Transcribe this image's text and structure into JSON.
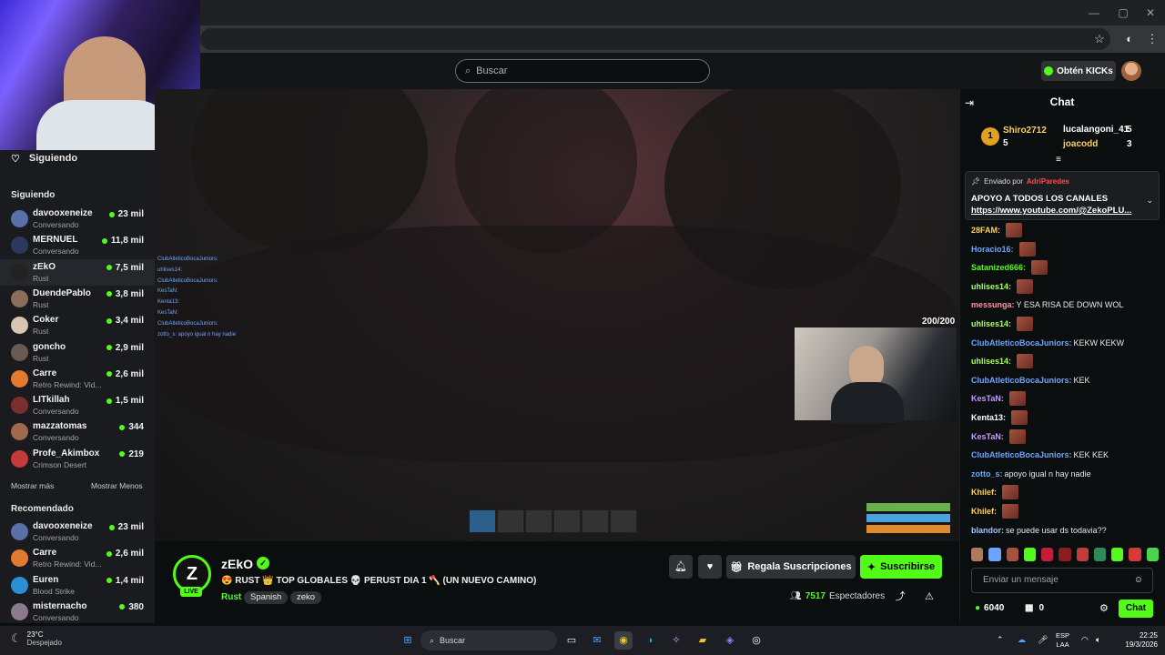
{
  "browser": {
    "window_controls": [
      "—",
      "▢",
      "✕"
    ]
  },
  "topnav": {
    "search_placeholder": "Buscar",
    "kicks_label": "Obtén KICKs"
  },
  "sidebar": {
    "header": "Siguiendo",
    "following_title": "Siguiendo",
    "following": [
      {
        "name": "davooxeneize",
        "category": "Conversando",
        "viewers": "23 mil",
        "color": "#5b6fa8"
      },
      {
        "name": "MERNUEL",
        "category": "Conversando",
        "viewers": "11,8 mil",
        "color": "#2b3a5c"
      },
      {
        "name": "zEkO",
        "category": "Rust",
        "viewers": "7,5 mil",
        "color": "#222"
      },
      {
        "name": "DuendePablo",
        "category": "Rust",
        "viewers": "3,8 mil",
        "color": "#8a6e5a"
      },
      {
        "name": "Coker",
        "category": "Rust",
        "viewers": "3,4 mil",
        "color": "#d9c6b0"
      },
      {
        "name": "goncho",
        "category": "Rust",
        "viewers": "2,9 mil",
        "color": "#6b5a52"
      },
      {
        "name": "Carre",
        "category": "Retro Rewind: Vid...",
        "viewers": "2,6 mil",
        "color": "#e27a2f"
      },
      {
        "name": "LITkillah",
        "category": "Conversando",
        "viewers": "1,5 mil",
        "color": "#7a2f2f"
      },
      {
        "name": "mazzatomas",
        "category": "Conversando",
        "viewers": "344",
        "color": "#a06a50"
      },
      {
        "name": "Profe_Akimbox",
        "category": "Crimson Desert",
        "viewers": "219",
        "color": "#c23a3a"
      }
    ],
    "show_more": "Mostrar más",
    "show_less": "Mostrar Menos",
    "recommended_title": "Recomendado",
    "recommended": [
      {
        "name": "davooxeneize",
        "category": "Conversando",
        "viewers": "23 mil",
        "color": "#5b6fa8"
      },
      {
        "name": "Carre",
        "category": "Retro Rewind: Vid...",
        "viewers": "2,6 mil",
        "color": "#e27a2f"
      },
      {
        "name": "Euren",
        "category": "Blood Strike",
        "viewers": "1,4 mil",
        "color": "#2c8fd4"
      },
      {
        "name": "misternacho",
        "category": "Conversando",
        "viewers": "380",
        "color": "#8a7a8c"
      }
    ]
  },
  "video": {
    "killfeed": [
      "ClubAtleticoBocaJuniors:",
      "uhlises14:",
      "ClubAtleticoBocaJuniors:",
      "KesTaN:",
      "Kenta13:",
      "KesTaN:",
      "ClubAtleticoBocaJuniors:",
      "zotto_s: apoyo igual n hay nadie"
    ],
    "health": "200/200",
    "hud_values": [
      "100",
      "100",
      "100"
    ]
  },
  "stream": {
    "streamer": "zEkO",
    "logo_letter": "Z",
    "live_badge": "LIVE",
    "title": "😍 RUST 👑 TOP GLOBALES 💀 PERUST DIA 1 🪓 (UN NUEVO CAMINO)",
    "category": "Rust",
    "tags": [
      "Spanish",
      "zeko"
    ],
    "gift_label": "Regala Suscripciones",
    "subscribe_label": "Suscribirse",
    "viewers_count": "7517",
    "viewers_label": "Espectadores"
  },
  "chat": {
    "title": "Chat",
    "leaderboard": [
      {
        "name": "Shiro2712",
        "count": "5"
      },
      {
        "name": "lucalangoni_41",
        "count": "5"
      },
      {
        "name": "joacodd",
        "count": "3"
      }
    ],
    "pinned": {
      "by_label": "Enviado por",
      "by_user": "AdriParedes",
      "message": "APOYO A TODOS LOS CANALES",
      "link": "https://www.youtube.com/@ZekoPLU..."
    },
    "messages": [
      {
        "user": "28FAM:",
        "text": "",
        "color": "#ffd15c",
        "emote": true
      },
      {
        "user": "Horacio16:",
        "text": "",
        "color": "#6ea4ff",
        "emote": true
      },
      {
        "user": "Satanized666:",
        "text": "",
        "color": "#53fc18",
        "emote": true
      },
      {
        "user": "uhlises14:",
        "text": "",
        "color": "#a8ff60",
        "emote": true
      },
      {
        "user": "messunga:",
        "text": "Y ESA RISA DE DOWN WOL",
        "color": "#ff8fa3",
        "emote": false
      },
      {
        "user": "uhlises14:",
        "text": "",
        "color": "#a8ff60",
        "emote": true
      },
      {
        "user": "ClubAtleticoBocaJuniors:",
        "text": "KEKW KEKW",
        "color": "#6ea4ff",
        "emote": false
      },
      {
        "user": "uhlises14:",
        "text": "",
        "color": "#a8ff60",
        "emote": true
      },
      {
        "user": "ClubAtleticoBocaJuniors:",
        "text": "KEK",
        "color": "#6ea4ff",
        "emote": false
      },
      {
        "user": "KesTaN:",
        "text": "",
        "color": "#c39cff",
        "emote": true
      },
      {
        "user": "Kenta13:",
        "text": "",
        "color": "#ffffff",
        "emote": true
      },
      {
        "user": "KesTaN:",
        "text": "",
        "color": "#c39cff",
        "emote": true
      },
      {
        "user": "ClubAtleticoBocaJuniors:",
        "text": "KEK KEK",
        "color": "#6ea4ff",
        "emote": false
      },
      {
        "user": "zotto_s:",
        "text": "apoyo igual n hay nadie",
        "color": "#6ea4ff",
        "emote": false
      },
      {
        "user": "Khilef:",
        "text": "",
        "color": "#ffd15c",
        "emote": true
      },
      {
        "user": "Khilef:",
        "text": "",
        "color": "#ffd15c",
        "emote": true
      },
      {
        "user": "blandor:",
        "text": "se puede usar ds todavia??",
        "color": "#9ec3ff",
        "emote": false
      }
    ],
    "input_placeholder": "Enviar un mensaje",
    "points": "6040",
    "points_secondary": "0",
    "send_label": "Chat"
  },
  "taskbar": {
    "temperature": "23°C",
    "weather": "Despejado",
    "search_label": "Buscar",
    "lang_top": "ESP",
    "lang_bottom": "LAA",
    "time": "22:25",
    "date": "19/3/2026"
  }
}
